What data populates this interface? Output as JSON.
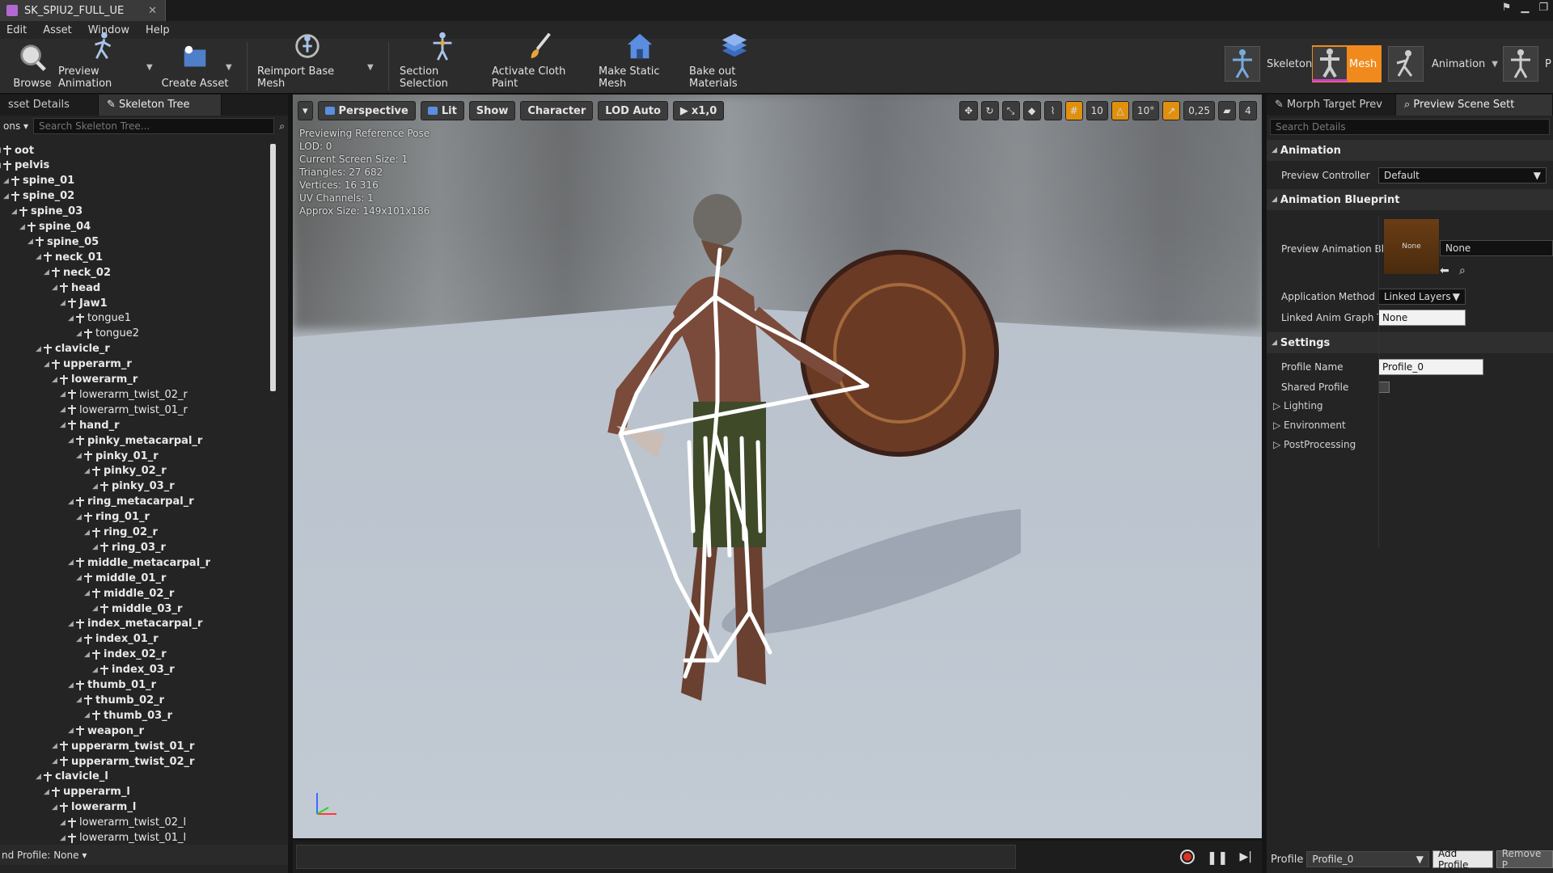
{
  "title": {
    "doc_tab": "SK_SPIU2_FULL_UE"
  },
  "menu": [
    "Edit",
    "Asset",
    "Window",
    "Help"
  ],
  "toolbar": {
    "browse": "Browse",
    "preview_animation": "Preview Animation",
    "create_asset": "Create Asset",
    "reimport": "Reimport Base Mesh",
    "section_selection": "Section Selection",
    "activate_cloth": "Activate Cloth Paint",
    "make_static": "Make Static Mesh",
    "bake_out": "Bake out Materials",
    "modes": {
      "skeleton": "Skeleton",
      "mesh": "Mesh",
      "animation": "Animation",
      "physics": "P"
    }
  },
  "left": {
    "tabs": [
      "sset Details",
      "Skeleton Tree"
    ],
    "options_label": "ons",
    "search_placeholder": "Search Skeleton Tree...",
    "footer": "nd Profile: None",
    "bones": [
      {
        "name": "oot",
        "depth": 0,
        "bold": true
      },
      {
        "name": "pelvis",
        "depth": 0,
        "bold": true
      },
      {
        "name": "spine_01",
        "depth": 1,
        "bold": true
      },
      {
        "name": "spine_02",
        "depth": 1,
        "bold": true
      },
      {
        "name": "spine_03",
        "depth": 2,
        "bold": true
      },
      {
        "name": "spine_04",
        "depth": 3,
        "bold": true
      },
      {
        "name": "spine_05",
        "depth": 4,
        "bold": true
      },
      {
        "name": "neck_01",
        "depth": 5,
        "bold": true
      },
      {
        "name": "neck_02",
        "depth": 6,
        "bold": true
      },
      {
        "name": "head",
        "depth": 7,
        "bold": true
      },
      {
        "name": "Jaw1",
        "depth": 8,
        "bold": true
      },
      {
        "name": "tongue1",
        "depth": 9,
        "bold": false
      },
      {
        "name": "tongue2",
        "depth": 10,
        "bold": false
      },
      {
        "name": "clavicle_r",
        "depth": 5,
        "bold": true
      },
      {
        "name": "upperarm_r",
        "depth": 6,
        "bold": true
      },
      {
        "name": "lowerarm_r",
        "depth": 7,
        "bold": true
      },
      {
        "name": "lowerarm_twist_02_r",
        "depth": 8,
        "bold": false
      },
      {
        "name": "lowerarm_twist_01_r",
        "depth": 8,
        "bold": false
      },
      {
        "name": "hand_r",
        "depth": 8,
        "bold": true
      },
      {
        "name": "pinky_metacarpal_r",
        "depth": 9,
        "bold": true
      },
      {
        "name": "pinky_01_r",
        "depth": 10,
        "bold": true
      },
      {
        "name": "pinky_02_r",
        "depth": 11,
        "bold": true
      },
      {
        "name": "pinky_03_r",
        "depth": 12,
        "bold": true
      },
      {
        "name": "ring_metacarpal_r",
        "depth": 9,
        "bold": true
      },
      {
        "name": "ring_01_r",
        "depth": 10,
        "bold": true
      },
      {
        "name": "ring_02_r",
        "depth": 11,
        "bold": true
      },
      {
        "name": "ring_03_r",
        "depth": 12,
        "bold": true
      },
      {
        "name": "middle_metacarpal_r",
        "depth": 9,
        "bold": true
      },
      {
        "name": "middle_01_r",
        "depth": 10,
        "bold": true
      },
      {
        "name": "middle_02_r",
        "depth": 11,
        "bold": true
      },
      {
        "name": "middle_03_r",
        "depth": 12,
        "bold": true
      },
      {
        "name": "index_metacarpal_r",
        "depth": 9,
        "bold": true
      },
      {
        "name": "index_01_r",
        "depth": 10,
        "bold": true
      },
      {
        "name": "index_02_r",
        "depth": 11,
        "bold": true
      },
      {
        "name": "index_03_r",
        "depth": 12,
        "bold": true
      },
      {
        "name": "thumb_01_r",
        "depth": 9,
        "bold": true
      },
      {
        "name": "thumb_02_r",
        "depth": 10,
        "bold": true
      },
      {
        "name": "thumb_03_r",
        "depth": 11,
        "bold": true
      },
      {
        "name": "weapon_r",
        "depth": 9,
        "bold": true
      },
      {
        "name": "upperarm_twist_01_r",
        "depth": 7,
        "bold": true
      },
      {
        "name": "upperarm_twist_02_r",
        "depth": 7,
        "bold": true
      },
      {
        "name": "clavicle_l",
        "depth": 5,
        "bold": true
      },
      {
        "name": "upperarm_l",
        "depth": 6,
        "bold": true
      },
      {
        "name": "lowerarm_l",
        "depth": 7,
        "bold": true
      },
      {
        "name": "lowerarm_twist_02_l",
        "depth": 8,
        "bold": false
      },
      {
        "name": "lowerarm_twist_01_l",
        "depth": 8,
        "bold": false
      }
    ]
  },
  "viewport": {
    "perspective": "Perspective",
    "lit": "Lit",
    "show": "Show",
    "character": "Character",
    "lod": "LOD Auto",
    "speed": "x1,0",
    "grid": "10",
    "angle": "10°",
    "scale": "0,25",
    "cam_speed": "4",
    "stats": [
      "Previewing Reference Pose",
      "LOD: 0",
      "Current Screen Size: 1",
      "Triangles: 27 682",
      "Vertices: 16 316",
      "UV Channels: 1",
      "Approx Size: 149x101x186"
    ]
  },
  "right": {
    "tabs": [
      "Morph Target Prev",
      "Preview Scene Sett"
    ],
    "search_placeholder": "Search Details",
    "sections": {
      "animation": "Animation",
      "blueprint": "Animation Blueprint",
      "settings": "Settings"
    },
    "preview_controller_label": "Preview Controller",
    "preview_controller_value": "Default",
    "preview_bp_label": "Preview Animation Bl",
    "thumb_label": "None",
    "preview_bp_value": "None",
    "app_method_label": "Application Method",
    "app_method_value": "Linked Layers",
    "linked_graph_label": "Linked Anim Graph Ta",
    "linked_graph_value": "None",
    "profile_name_label": "Profile Name",
    "profile_name_value": "Profile_0",
    "shared_profile_label": "Shared Profile",
    "subsections": [
      "Lighting",
      "Environment",
      "PostProcessing"
    ],
    "footer": {
      "label": "Profile",
      "value": "Profile_0",
      "add": "Add Profile",
      "remove": "Remove P"
    }
  }
}
